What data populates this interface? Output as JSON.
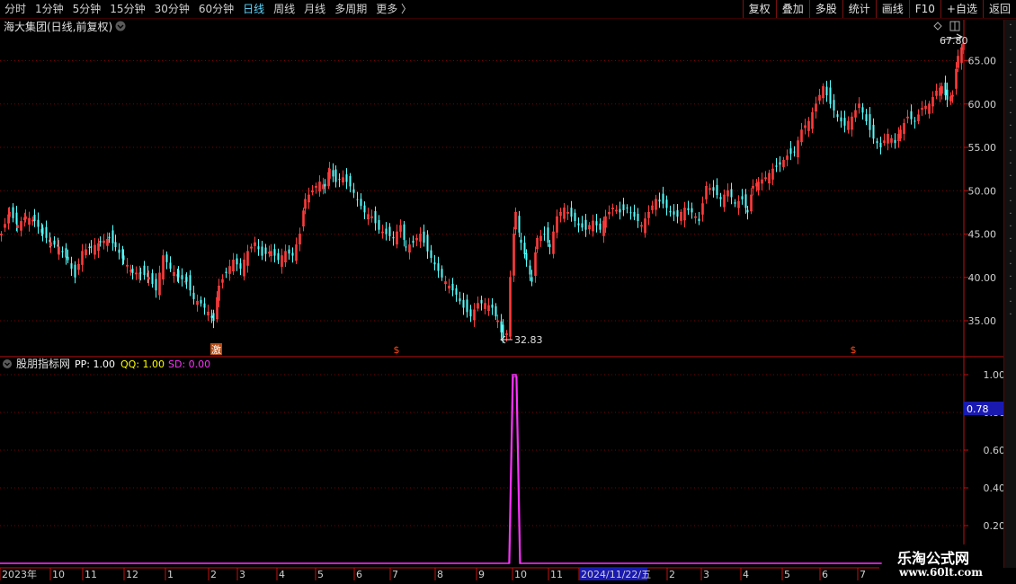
{
  "toolbar": {
    "periods": [
      {
        "label": "分时",
        "active": false
      },
      {
        "label": "1分钟",
        "active": false
      },
      {
        "label": "5分钟",
        "active": false
      },
      {
        "label": "15分钟",
        "active": false
      },
      {
        "label": "30分钟",
        "active": false
      },
      {
        "label": "60分钟",
        "active": false
      },
      {
        "label": "日线",
        "active": true
      },
      {
        "label": "周线",
        "active": false
      },
      {
        "label": "月线",
        "active": false
      },
      {
        "label": "多周期",
        "active": false
      },
      {
        "label": "更多 〉",
        "active": false
      }
    ],
    "buttons": [
      "复权",
      "叠加",
      "多股",
      "统计",
      "画线",
      "F10",
      "+自选",
      "返回"
    ]
  },
  "main_title": "海大集团(日线,前复权)",
  "colors": {
    "up": "#ff3b3b",
    "down": "#54ffff",
    "grid": "#7a0000",
    "axis": "#c01010",
    "indicator": "#ff33ff",
    "pp": "#ffffff",
    "qq": "#ffff00",
    "sd": "#ff33ff",
    "marker": "#ff4a1a",
    "accent": "#1a1ab0"
  },
  "annotations": {
    "max_label": "67.80",
    "min_label": "32.83"
  },
  "markers": [
    "激",
    "$",
    "$"
  ],
  "indicator": {
    "name": "股朋指标网",
    "pp_label": "PP: 1.00",
    "qq_label": "QQ: 1.00",
    "sd_label": "SD: 0.00",
    "axis_badge": "0.78"
  },
  "chart_data": [
    {
      "type": "candlestick",
      "x_labels": [
        "2023年",
        "10",
        "11",
        "12",
        "1",
        "2",
        "3",
        "4",
        "5",
        "6",
        "7",
        "8",
        "9",
        "10",
        "11",
        "2024/11/22/五",
        "2",
        "3",
        "4",
        "5",
        "6",
        "7"
      ],
      "y_ticks": [
        35,
        40,
        45,
        50,
        55,
        60,
        65
      ],
      "ylim": [
        31,
        68.5
      ],
      "series": [
        {
          "values": [
            [
              0,
              45
            ],
            [
              9,
              47.5
            ],
            [
              18,
              46
            ],
            [
              27,
              47
            ],
            [
              37,
              46.5
            ],
            [
              46,
              45
            ],
            [
              55,
              44
            ],
            [
              64,
              43.5
            ],
            [
              74,
              42
            ],
            [
              82,
              40
            ],
            [
              90,
              43
            ],
            [
              100,
              43.5
            ],
            [
              110,
              44
            ],
            [
              120,
              44.5
            ],
            [
              127,
              43.5
            ],
            [
              136,
              42
            ],
            [
              146,
              40.5
            ],
            [
              155,
              40.5
            ],
            [
              164,
              40
            ],
            [
              172,
              38.5
            ],
            [
              180,
              42.5
            ],
            [
              188,
              41
            ],
            [
              197,
              40
            ],
            [
              206,
              39.5
            ],
            [
              214,
              37.5
            ],
            [
              222,
              37
            ],
            [
              230,
              36
            ],
            [
              236,
              35
            ],
            [
              242,
              39
            ],
            [
              250,
              40.5
            ],
            [
              258,
              42
            ],
            [
              266,
              41
            ],
            [
              274,
              43
            ],
            [
              282,
              44
            ],
            [
              290,
              42.5
            ],
            [
              300,
              43
            ],
            [
              308,
              42
            ],
            [
              316,
              43
            ],
            [
              324,
              42.5
            ],
            [
              332,
              45
            ],
            [
              338,
              49
            ],
            [
              346,
              50
            ],
            [
              354,
              51
            ],
            [
              360,
              50.5
            ],
            [
              365,
              52.5
            ],
            [
              372,
              51
            ],
            [
              380,
              51.5
            ],
            [
              388,
              50.5
            ],
            [
              396,
              49
            ],
            [
              404,
              47.5
            ],
            [
              412,
              47
            ],
            [
              420,
              45.5
            ],
            [
              428,
              45
            ],
            [
              436,
              44.5
            ],
            [
              444,
              46
            ],
            [
              450,
              43.5
            ],
            [
              458,
              44
            ],
            [
              466,
              45
            ],
            [
              474,
              43
            ],
            [
              482,
              41.5
            ],
            [
              490,
              40
            ],
            [
              498,
              39
            ],
            [
              506,
              38
            ],
            [
              514,
              36.5
            ],
            [
              522,
              35.5
            ],
            [
              530,
              37
            ],
            [
              538,
              37
            ],
            [
              546,
              36.5
            ],
            [
              552,
              35
            ],
            [
              558,
              33
            ],
            [
              562,
              33.5
            ],
            [
              566,
              40
            ],
            [
              572,
              47.5
            ],
            [
              578,
              44
            ],
            [
              584,
              42
            ],
            [
              590,
              39.5
            ],
            [
              596,
              44.5
            ],
            [
              604,
              45
            ],
            [
              610,
              43.5
            ],
            [
              618,
              47
            ],
            [
              626,
              48
            ],
            [
              634,
              47
            ],
            [
              642,
              46
            ],
            [
              650,
              45.5
            ],
            [
              658,
              46.5
            ],
            [
              666,
              45.5
            ],
            [
              672,
              47
            ],
            [
              680,
              48
            ],
            [
              688,
              47.5
            ],
            [
              696,
              48
            ],
            [
              704,
              47
            ],
            [
              712,
              46
            ],
            [
              720,
              47.5
            ],
            [
              728,
              49
            ],
            [
              736,
              48.5
            ],
            [
              744,
              47.5
            ],
            [
              752,
              47
            ],
            [
              760,
              48
            ],
            [
              768,
              47.5
            ],
            [
              776,
              46.5
            ],
            [
              784,
              50.5
            ],
            [
              792,
              50
            ],
            [
              800,
              49
            ],
            [
              808,
              50
            ],
            [
              816,
              48.5
            ],
            [
              824,
              49
            ],
            [
              830,
              47.5
            ],
            [
              836,
              50.5
            ],
            [
              842,
              51
            ],
            [
              850,
              51.5
            ],
            [
              858,
              52.5
            ],
            [
              866,
              53
            ],
            [
              874,
              54
            ],
            [
              882,
              54.5
            ],
            [
              890,
              57
            ],
            [
              898,
              58
            ],
            [
              906,
              60
            ],
            [
              914,
              62
            ],
            [
              922,
              60
            ],
            [
              930,
              58.5
            ],
            [
              938,
              57.5
            ],
            [
              946,
              58.5
            ],
            [
              954,
              60
            ],
            [
              962,
              58
            ],
            [
              970,
              56
            ],
            [
              978,
              55
            ],
            [
              986,
              56.5
            ],
            [
              994,
              55.5
            ],
            [
              1000,
              57
            ],
            [
              1008,
              58.5
            ],
            [
              1016,
              58
            ],
            [
              1024,
              59.5
            ],
            [
              1032,
              60
            ],
            [
              1040,
              61.5
            ],
            [
              1046,
              62
            ],
            [
              1052,
              60.5
            ],
            [
              1058,
              61
            ],
            [
              1064,
              65.5
            ],
            [
              1070,
              67
            ]
          ]
        }
      ],
      "max_point": {
        "x_index": 1070,
        "value": 67.8
      },
      "min_point": {
        "x_index": 558,
        "value": 32.83
      },
      "grid": true
    },
    {
      "type": "line",
      "y_ticks": [
        0.2,
        0.4,
        0.6,
        0.8,
        1.0
      ],
      "ylim": [
        0,
        1.05
      ],
      "series": [
        {
          "name": "SD",
          "values": [
            [
              0,
              0
            ],
            [
              566,
              0
            ],
            [
              570,
              1
            ],
            [
              574,
              1
            ],
            [
              578,
              0
            ],
            [
              980,
              0
            ]
          ]
        }
      ],
      "grid": true
    }
  ]
}
